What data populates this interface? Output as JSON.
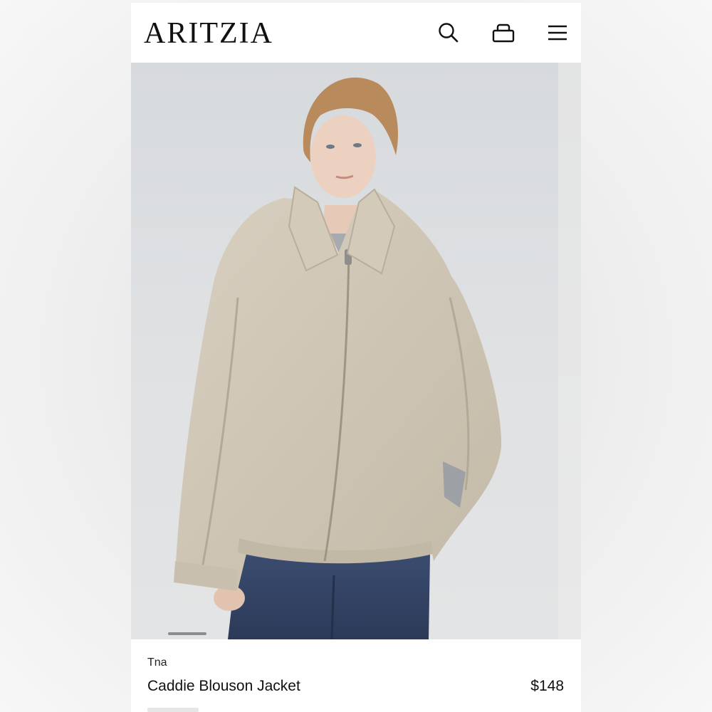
{
  "header": {
    "logo_text": "ARITZIA",
    "icons": [
      "search-icon",
      "bag-icon",
      "menu-icon"
    ]
  },
  "product": {
    "brand": "Tna",
    "name": "Caddie Blouson Jacket",
    "price": "$148"
  },
  "carousel": {
    "active_index": 0
  },
  "colors": {
    "jacket": "#cfc6b6",
    "jeans": "#34466a",
    "background": "#dcdfe1",
    "text": "#111111"
  }
}
